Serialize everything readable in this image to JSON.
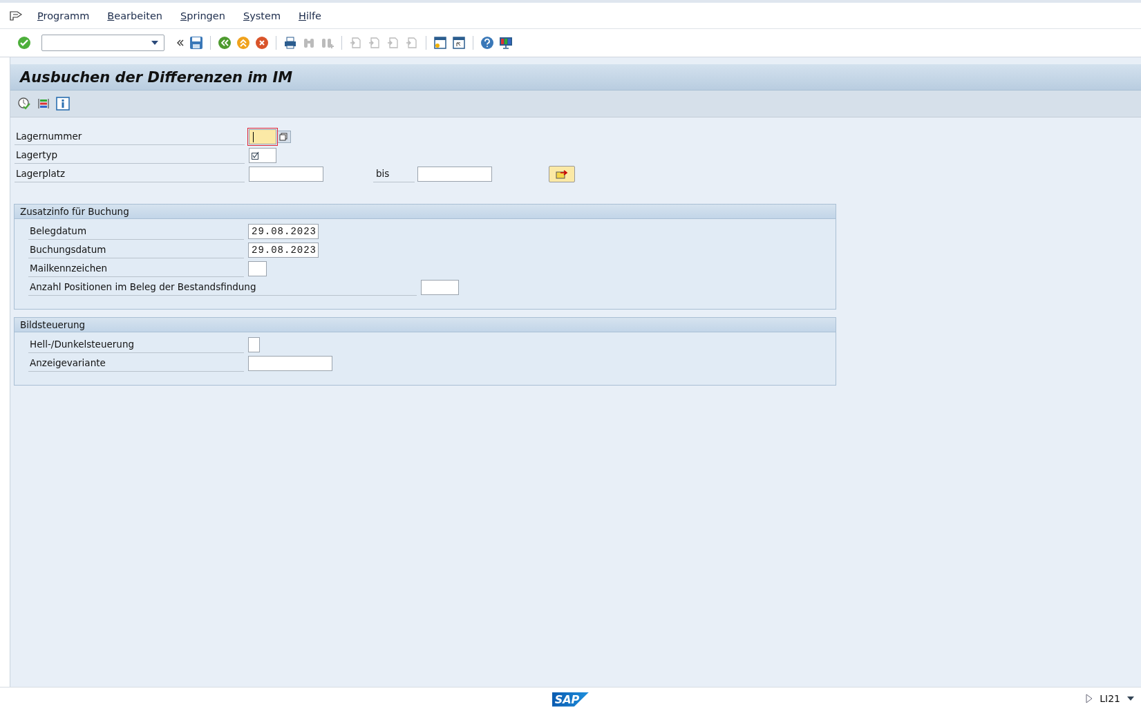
{
  "menu": [
    "Programm",
    "Bearbeiten",
    "Springen",
    "System",
    "Hilfe"
  ],
  "title": "Ausbuchen der Differenzen im IM",
  "selection": [
    {
      "label": "Lagernummer",
      "kind": "focused"
    },
    {
      "label": "Lagertyp",
      "kind": "multi"
    },
    {
      "label": "Lagerplatz",
      "kind": "range",
      "to_label": "bis"
    }
  ],
  "groups": [
    {
      "title": "Zusatzinfo für Buchung",
      "fields": [
        {
          "label": "Belegdatum",
          "value": "29.08.2023"
        },
        {
          "label": "Buchungsdatum",
          "value": "29.08.2023"
        },
        {
          "label": "Mailkennzeichen"
        },
        {
          "label": "Anzahl Positionen im Beleg der Bestandsfindung"
        }
      ]
    },
    {
      "title": "Bildsteuerung",
      "fields": [
        {
          "label": "Hell-/Dunkelsteuerung"
        },
        {
          "label": "Anzeigevariante"
        }
      ]
    }
  ],
  "status": {
    "logo": "SAP",
    "transaction": "LI21"
  }
}
